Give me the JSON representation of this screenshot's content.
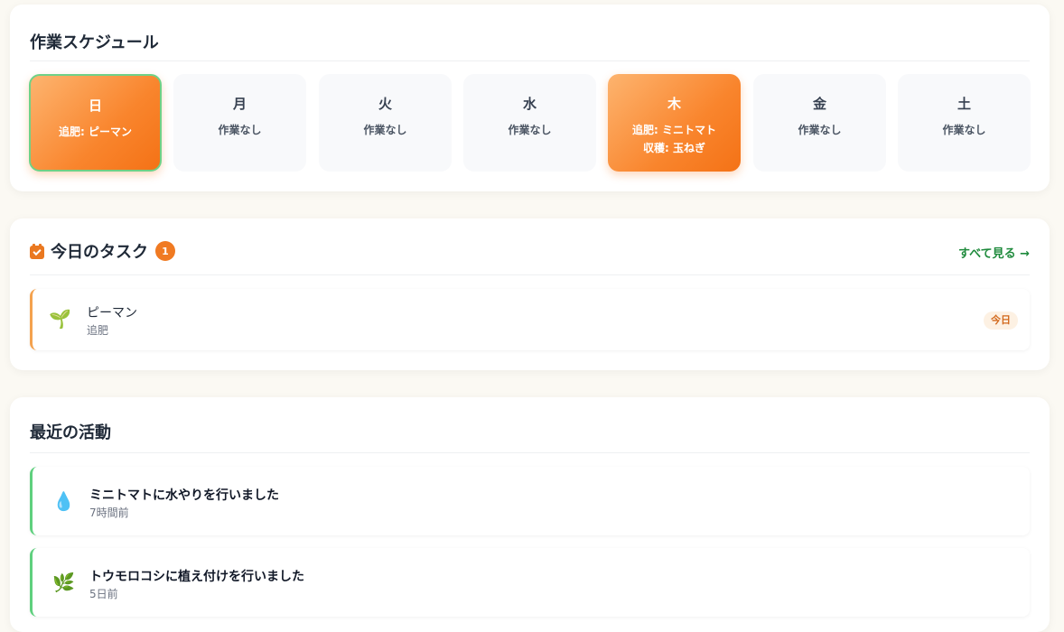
{
  "schedule": {
    "title": "作業スケジュール",
    "days": [
      {
        "name": "日",
        "tasks": [
          "追肥: ピーマン"
        ],
        "active": true,
        "today": true
      },
      {
        "name": "月",
        "tasks": [
          "作業なし"
        ],
        "active": false,
        "today": false
      },
      {
        "name": "火",
        "tasks": [
          "作業なし"
        ],
        "active": false,
        "today": false
      },
      {
        "name": "水",
        "tasks": [
          "作業なし"
        ],
        "active": false,
        "today": false
      },
      {
        "name": "木",
        "tasks": [
          "追肥: ミニトマト",
          "収穫: 玉ねぎ"
        ],
        "active": true,
        "today": false
      },
      {
        "name": "金",
        "tasks": [
          "作業なし"
        ],
        "active": false,
        "today": false
      },
      {
        "name": "土",
        "tasks": [
          "作業なし"
        ],
        "active": false,
        "today": false
      }
    ]
  },
  "tasks": {
    "title": "今日のタスク",
    "count": "1",
    "see_all": "すべて見る →",
    "items": [
      {
        "icon": "seedling-icon",
        "emoji": "🌱",
        "name": "ピーマン",
        "type": "追肥",
        "badge": "今日"
      }
    ]
  },
  "activity": {
    "title": "最近の活動",
    "items": [
      {
        "icon": "water-drop-icon",
        "emoji": "💧",
        "text": "ミニトマトに水やりを行いました",
        "time": "7時間前"
      },
      {
        "icon": "herb-icon",
        "emoji": "🌿",
        "text": "トウモロコシに植え付けを行いました",
        "time": "5日前"
      }
    ]
  },
  "colors": {
    "accent_orange": "#f47216",
    "today_border": "#6fd187",
    "activity_border": "#5fd07e",
    "task_border": "#f4a24f",
    "link_green": "#1e8a3c"
  }
}
